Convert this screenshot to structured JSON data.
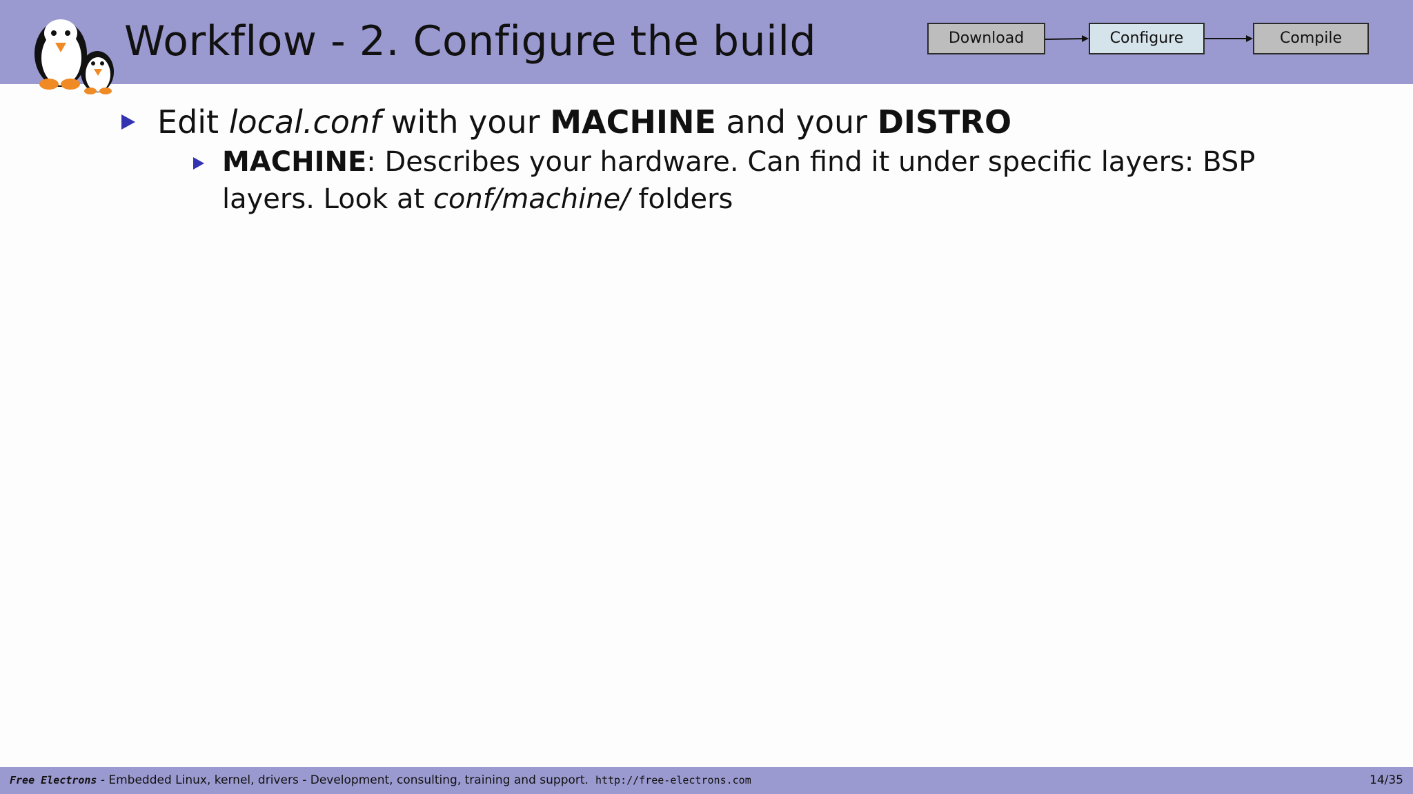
{
  "header": {
    "title": "Workflow - 2. Configure the build",
    "logo_icon": "penguins-logo-icon",
    "background_color": "#9b9ad0"
  },
  "workflow": {
    "steps": [
      {
        "label": "Download",
        "color": "#bdbdbd"
      },
      {
        "label": "Configure",
        "color": "#d5e3ea",
        "active": true
      },
      {
        "label": "Compile",
        "color": "#bdbdbd"
      }
    ]
  },
  "content": {
    "bullet1": {
      "edit": "Edit ",
      "localconf": "local.conf",
      "with_your": " with your ",
      "machine": "MACHINE",
      "and_your": " and your ",
      "distro": "DISTRO"
    },
    "bullet2": {
      "machine": "MACHINE",
      "desc": ": Describes your hardware.  Can find it under specific layers: BSP layers. Look at ",
      "path": "conf/machine/",
      "folders": " folders"
    }
  },
  "footer": {
    "brand": "Free Electrons",
    "tagline": " - Embedded Linux, kernel, drivers - Development, consulting, training and support.",
    "url": "http://free-electrons.com",
    "page": "14/35"
  }
}
